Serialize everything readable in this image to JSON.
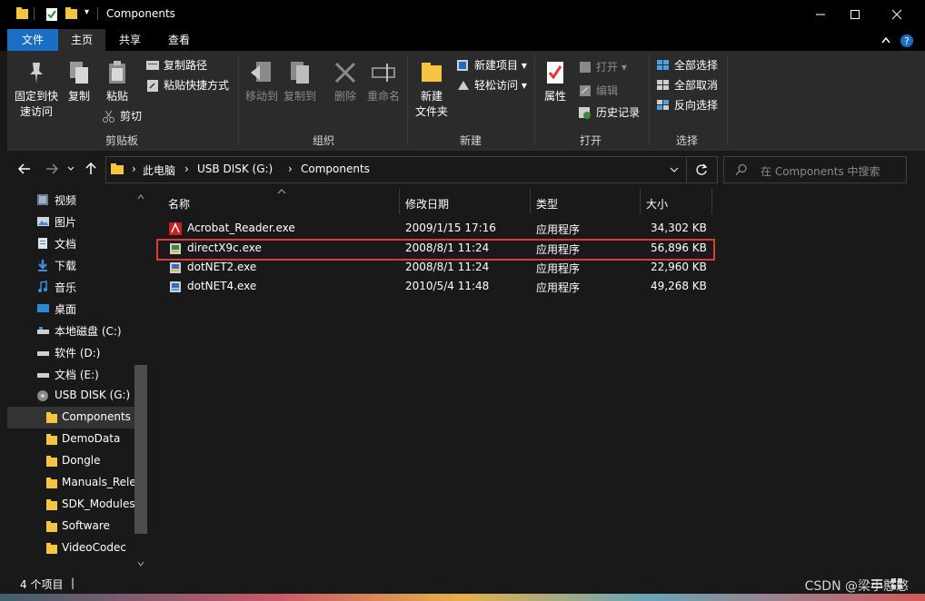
{
  "window": {
    "title": "Components",
    "controls": [
      "minimize",
      "maximize",
      "close"
    ]
  },
  "ribbon_tabs": [
    {
      "label": "文件"
    },
    {
      "label": "主页"
    },
    {
      "label": "共享"
    },
    {
      "label": "查看"
    }
  ],
  "ribbon": {
    "clipboard": {
      "pin": "固定到快\n速访问",
      "copy": "复制",
      "paste": "粘贴",
      "copy_path": "复制路径",
      "paste_shortcut": "粘贴快捷方式",
      "cut": "剪切",
      "group": "剪贴板"
    },
    "organize": {
      "move_to": "移动到",
      "copy_to": "复制到",
      "delete": "删除",
      "rename": "重命名",
      "group": "组织"
    },
    "new": {
      "new_folder": "新建\n文件夹",
      "new_item": "新建项目",
      "easy_access": "轻松访问",
      "group": "新建"
    },
    "open": {
      "properties": "属性",
      "open": "打开",
      "edit": "编辑",
      "history": "历史记录",
      "group": "打开"
    },
    "select": {
      "select_all": "全部选择",
      "select_none": "全部取消",
      "invert": "反向选择",
      "group": "选择"
    }
  },
  "address": {
    "crumbs": [
      "此电脑",
      "USB DISK (G:)",
      "Components"
    ],
    "search_placeholder": "在 Components 中搜索"
  },
  "nav_pane": [
    {
      "label": "视频",
      "icon": "video-icon",
      "indent": 1
    },
    {
      "label": "图片",
      "icon": "picture-icon",
      "indent": 1
    },
    {
      "label": "文档",
      "icon": "document-icon",
      "indent": 1
    },
    {
      "label": "下载",
      "icon": "download-icon",
      "indent": 1
    },
    {
      "label": "音乐",
      "icon": "music-icon",
      "indent": 1
    },
    {
      "label": "桌面",
      "icon": "desktop-icon",
      "indent": 1
    },
    {
      "label": "本地磁盘 (C:)",
      "icon": "drive-icon",
      "indent": 1
    },
    {
      "label": "软件 (D:)",
      "icon": "drive-icon",
      "indent": 1
    },
    {
      "label": "文档 (E:)",
      "icon": "drive-icon",
      "indent": 1
    },
    {
      "label": "USB DISK (G:)",
      "icon": "usb-drive-icon",
      "indent": 1
    },
    {
      "label": "Components",
      "icon": "folder-icon",
      "indent": 2,
      "selected": true
    },
    {
      "label": "DemoData",
      "icon": "folder-icon",
      "indent": 2
    },
    {
      "label": "Dongle",
      "icon": "folder-icon",
      "indent": 2
    },
    {
      "label": "Manuals_Rele",
      "icon": "folder-icon",
      "indent": 2
    },
    {
      "label": "SDK_Modules",
      "icon": "folder-icon",
      "indent": 2
    },
    {
      "label": "Software",
      "icon": "folder-icon",
      "indent": 2
    },
    {
      "label": "VideoCodec",
      "icon": "folder-icon",
      "indent": 2
    }
  ],
  "columns": [
    "名称",
    "修改日期",
    "类型",
    "大小"
  ],
  "files": [
    {
      "name": "Acrobat_Reader.exe",
      "date": "2009/1/15 17:16",
      "type": "应用程序",
      "size": "34,302 KB",
      "icon": "acrobat-icon"
    },
    {
      "name": "directX9c.exe",
      "date": "2008/8/1 11:24",
      "type": "应用程序",
      "size": "56,896 KB",
      "icon": "installer-icon",
      "highlighted": true
    },
    {
      "name": "dotNET2.exe",
      "date": "2008/8/1 11:24",
      "type": "应用程序",
      "size": "22,960 KB",
      "icon": "installer-icon"
    },
    {
      "name": "dotNET4.exe",
      "date": "2010/5/4 11:48",
      "type": "应用程序",
      "size": "49,268 KB",
      "icon": "installer-icon"
    }
  ],
  "status": {
    "item_count": "4 个项目",
    "cursor": "|"
  },
  "watermark": "CSDN @梁小憨憨",
  "colors": {
    "file_tab": "#1a6fc4",
    "highlight_border": "#e0393a",
    "folder": "#f6c443"
  }
}
